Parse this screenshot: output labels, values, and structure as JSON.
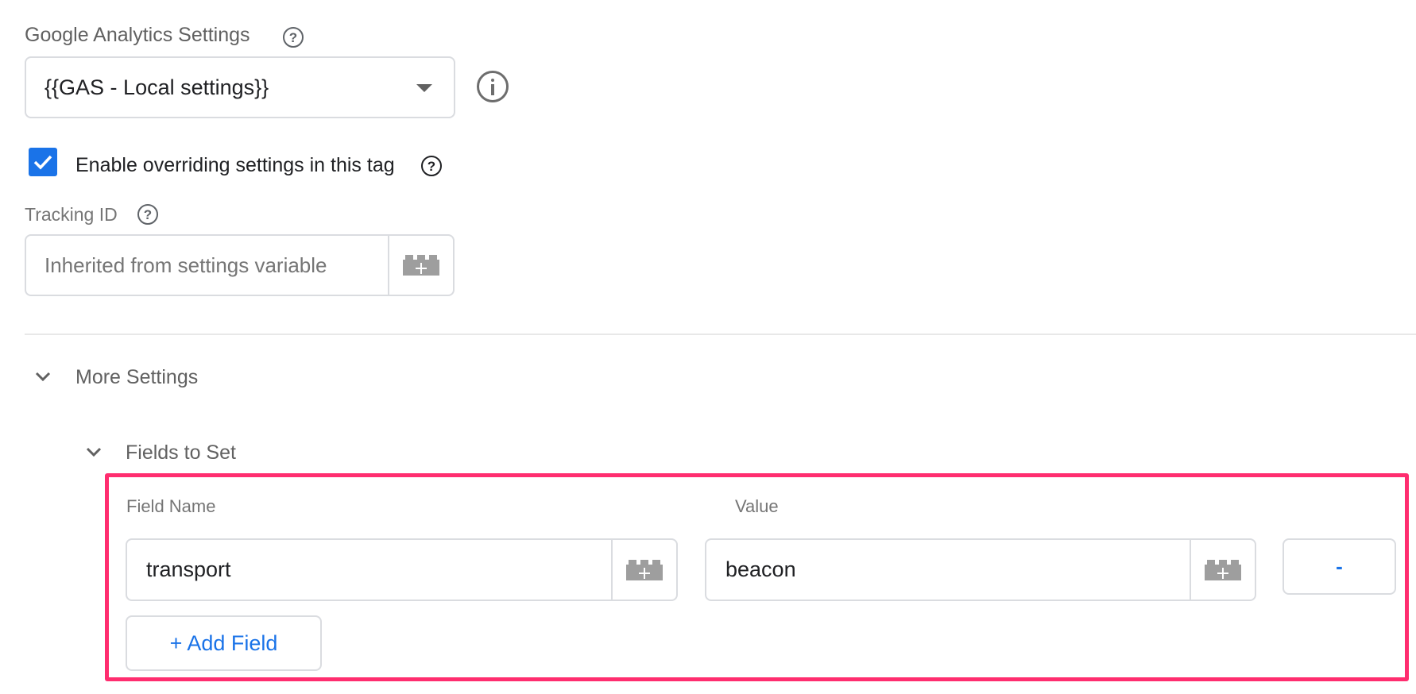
{
  "ga_settings": {
    "label": "Google Analytics Settings",
    "help_icon": "help-circle-icon",
    "selected_value": "{{GAS - Local settings}}",
    "dropdown_icon": "caret-down-icon",
    "info_icon": "info-circle-icon"
  },
  "override": {
    "checked": true,
    "label": "Enable overriding settings in this tag",
    "help_icon": "help-circle-icon"
  },
  "tracking_id": {
    "label": "Tracking ID",
    "help_icon": "help-circle-icon",
    "value": "",
    "placeholder": "Inherited from settings variable",
    "variable_icon": "add-variable-brick-icon"
  },
  "more_settings": {
    "label": "More Settings",
    "expanded": true,
    "fields_to_set": {
      "label": "Fields to Set",
      "expanded": true,
      "columns": {
        "name": "Field Name",
        "value": "Value"
      },
      "rows": [
        {
          "name": "transport",
          "value": "beacon",
          "remove_label": "-"
        }
      ],
      "add_label": "+ Add Field"
    }
  },
  "highlight": {
    "color": "#ff2d6f"
  },
  "colors": {
    "accent": "#1a73e8",
    "checkbox": "#1a73e8"
  }
}
